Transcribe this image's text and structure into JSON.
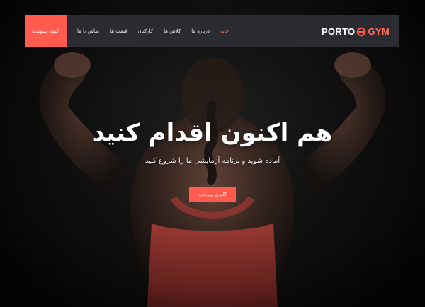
{
  "navbar": {
    "logo_primary": "PORTO",
    "logo_secondary": "GYM",
    "cta_label": "اکنون بپیوندید",
    "links": [
      {
        "label": "خانه",
        "active": true
      },
      {
        "label": "درباره ما",
        "active": false
      },
      {
        "label": "کلاس ها",
        "active": false
      },
      {
        "label": "کارکنان",
        "active": false
      },
      {
        "label": "قیمت ها",
        "active": false
      },
      {
        "label": "تماس با ما",
        "active": false
      }
    ]
  },
  "hero": {
    "title": "هم اکنون اقدام کنید",
    "subtitle": "آماده شوید و برنامه آزمایشی ما را شروع کنید",
    "cta_label": "اکنون بپیوندید"
  },
  "colors": {
    "accent": "#ff5b4f",
    "navbar_bg": "#2a2c31",
    "text": "#ffffff"
  },
  "icons": {
    "logo": "dumbbell-ring-icon"
  }
}
